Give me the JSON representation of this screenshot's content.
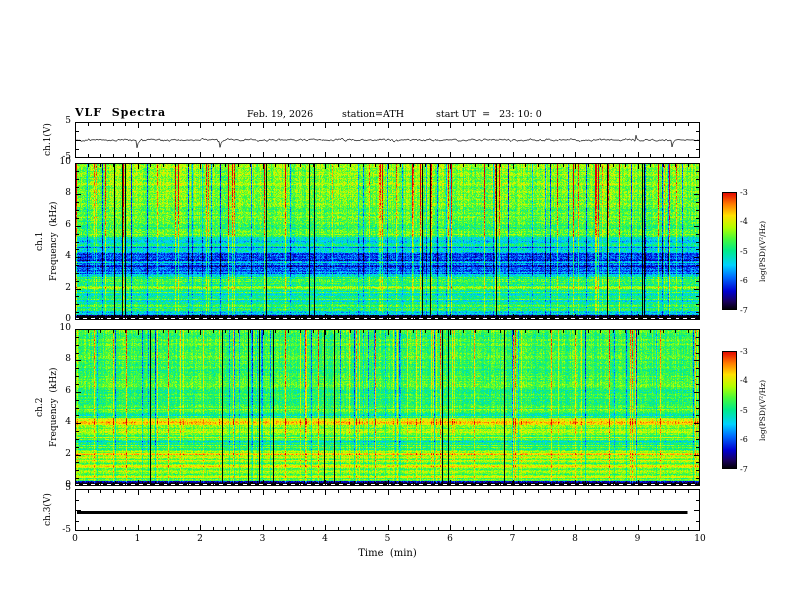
{
  "figure": {
    "title": "VLF  Spectra",
    "annotations": {
      "date": "Feb. 19, 2026",
      "station": "station=ATH",
      "start_ut": "start UT  =   23: 10: 0"
    },
    "xlabel": "Time  (min)",
    "xlim": [
      0,
      10
    ],
    "xticks": [
      0,
      1,
      2,
      3,
      4,
      5,
      6,
      7,
      8,
      9,
      10
    ],
    "xtick_minor": 0.2,
    "background": "#ffffff",
    "frame_color": "#000000"
  },
  "colorbar": {
    "label": "log(PSD)(V²/Hz)",
    "ticks": [
      -3,
      -4,
      -5,
      -6,
      -7
    ],
    "range": [
      -7,
      -3
    ]
  },
  "colormap": {
    "stops": [
      [
        0.0,
        [
          0,
          0,
          0
        ]
      ],
      [
        0.07,
        [
          25,
          0,
          90
        ]
      ],
      [
        0.16,
        [
          0,
          0,
          210
        ]
      ],
      [
        0.28,
        [
          0,
          110,
          255
        ]
      ],
      [
        0.38,
        [
          0,
          210,
          255
        ]
      ],
      [
        0.5,
        [
          0,
          235,
          140
        ]
      ],
      [
        0.6,
        [
          70,
          250,
          60
        ]
      ],
      [
        0.7,
        [
          180,
          255,
          0
        ]
      ],
      [
        0.8,
        [
          255,
          225,
          0
        ]
      ],
      [
        0.9,
        [
          255,
          120,
          0
        ]
      ],
      [
        1.0,
        [
          225,
          0,
          0
        ]
      ]
    ]
  },
  "chart_data": [
    {
      "id": "ch1-waveform",
      "type": "line",
      "ylabel": "ch.1(V)",
      "ylim": [
        -5,
        5
      ],
      "yticks": [
        5,
        -5
      ],
      "xlim": [
        0,
        10
      ],
      "mean": 0,
      "noise_amp": 0.55,
      "spike_prob": 0.015,
      "spike_amp": 2.6,
      "description": "broadband noise trace centred near 0 V with intermittent negative spikes"
    },
    {
      "id": "ch1-spectrogram",
      "type": "heatmap",
      "ylabel": "ch.1 Frequency (kHz)",
      "ylabel_ch": "ch.1",
      "ylabel_axis": "Frequency  (kHz)",
      "ylim": [
        0,
        10
      ],
      "yticks": [
        0,
        2,
        4,
        6,
        8,
        10
      ],
      "ytick_minor": 0.5,
      "ytick_major": 2,
      "zlabel": "log(PSD)(V²/Hz)",
      "zlim": [
        -7,
        -3
      ],
      "profile": [
        [
          0.0,
          -7.0
        ],
        [
          0.25,
          -7.0
        ],
        [
          0.35,
          -5.6
        ],
        [
          0.6,
          -5.0
        ],
        [
          1.0,
          -5.2
        ],
        [
          1.6,
          -4.8
        ],
        [
          2.4,
          -4.7
        ],
        [
          3.0,
          -5.6
        ],
        [
          3.6,
          -5.9
        ],
        [
          4.3,
          -5.7
        ],
        [
          5.0,
          -5.4
        ],
        [
          5.6,
          -4.7
        ],
        [
          6.5,
          -4.55
        ],
        [
          8.0,
          -4.45
        ],
        [
          10.0,
          -4.35
        ]
      ],
      "noise": 0.7,
      "row_structure": 0.45,
      "row_full_below": 5.5,
      "col_scale_low": 0.35,
      "col_scale_high": 1.1,
      "bright_col_prob": 0.08,
      "dark_col_prob": 0.05,
      "blackout_col_prob": 0.018,
      "bottom_dash_below": 0.1,
      "description": "green/yellow background above 5.5 kHz with red vertical bursts, blue quiet band 3-5 kHz, cyan banding below 2.5 kHz, black band below 0.3 kHz"
    },
    {
      "id": "ch2-spectrogram",
      "type": "heatmap",
      "ylabel": "ch.2 Frequency (kHz)",
      "ylabel_ch": "ch.2",
      "ylabel_axis": "Frequency  (kHz)",
      "ylim": [
        0,
        10
      ],
      "yticks": [
        0,
        2,
        4,
        6,
        8,
        10
      ],
      "ytick_minor": 0.5,
      "ytick_major": 2,
      "zlabel": "log(PSD)(V²/Hz)",
      "zlim": [
        -7,
        -3
      ],
      "profile": [
        [
          0.0,
          -7.0
        ],
        [
          0.25,
          -7.0
        ],
        [
          0.35,
          -4.9
        ],
        [
          0.6,
          -4.5
        ],
        [
          0.9,
          -4.8
        ],
        [
          1.3,
          -4.4
        ],
        [
          1.7,
          -3.8
        ],
        [
          2.0,
          -4.1
        ],
        [
          2.3,
          -4.7
        ],
        [
          2.8,
          -4.8
        ],
        [
          3.2,
          -4.2
        ],
        [
          3.6,
          -4.8
        ],
        [
          4.2,
          -4.3
        ],
        [
          4.6,
          -4.6
        ],
        [
          5.2,
          -4.8
        ],
        [
          6.0,
          -4.75
        ],
        [
          7.5,
          -4.7
        ],
        [
          9.0,
          -4.65
        ],
        [
          10.0,
          -4.6
        ]
      ],
      "noise": 0.6,
      "row_structure": 0.5,
      "row_full_below": 5.0,
      "col_scale_low": 0.3,
      "col_scale_high": 0.9,
      "bright_col_prob": 0.07,
      "dark_col_prob": 0.05,
      "blackout_col_prob": 0.015,
      "bottom_dash_below": 0.1,
      "description": "green background with vertical streaks, bright yellow-orange horizontal bands near 1.7, 3.2 and 4.2 kHz, black band below 0.3 kHz"
    },
    {
      "id": "ch3-trace",
      "type": "line",
      "ylabel": "ch.3(V)",
      "ylim": [
        -5,
        5
      ],
      "yticks": [
        5,
        -5
      ],
      "value": -0.5,
      "x_end": 9.8,
      "description": "constant flat thick black trace (channel inactive)"
    }
  ]
}
